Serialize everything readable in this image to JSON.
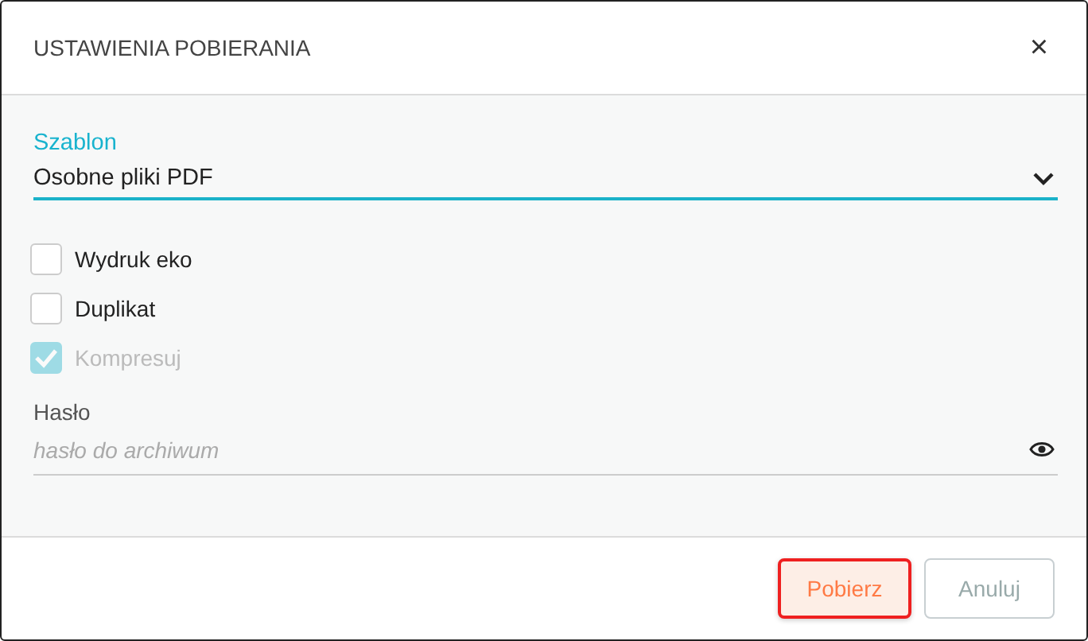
{
  "dialog": {
    "title": "USTAWIENIA POBIERANIA",
    "close": "×"
  },
  "template_field": {
    "label": "Szablon",
    "value": "Osobne pliki PDF"
  },
  "options": [
    {
      "label": "Wydruk eko",
      "checked": false,
      "disabled": false
    },
    {
      "label": "Duplikat",
      "checked": false,
      "disabled": false
    },
    {
      "label": "Kompresuj",
      "checked": true,
      "disabled": true
    }
  ],
  "password_field": {
    "label": "Hasło",
    "placeholder": "hasło do archiwum"
  },
  "buttons": [
    {
      "label": "Pobierz",
      "kind": "primary",
      "focused": true
    },
    {
      "label": "Anuluj",
      "kind": "secondary",
      "focused": false
    }
  ]
}
